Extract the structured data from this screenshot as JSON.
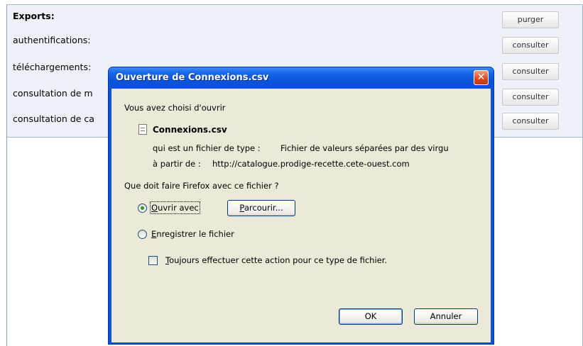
{
  "background": {
    "rows": [
      {
        "label": "Exports:",
        "button": "purger"
      },
      {
        "label": "authentifications:",
        "button": "consulter"
      },
      {
        "label": "téléchargements:",
        "button": "consulter"
      },
      {
        "label": "consultation de m",
        "button": "consulter"
      },
      {
        "label": "consultation de ca",
        "button": "consulter"
      }
    ]
  },
  "dialog": {
    "title": "Ouverture de Connexions.csv",
    "close_glyph": "✕",
    "intro": "Vous avez choisi d'ouvrir",
    "file_name": "Connexions.csv",
    "type_label": "qui est un fichier de type :",
    "type_value": "Fichier de valeurs séparées par des virgu",
    "from_label": "à partir de :",
    "from_value": "http://catalogue.prodige-recette.cete-ouest.com",
    "question": "Que doit faire Firefox avec ce fichier ?",
    "open_with": {
      "accel": "O",
      "rest": "uvrir avec",
      "checked": true
    },
    "browse": {
      "accel": "P",
      "rest": "arcourir..."
    },
    "save_file": {
      "accel": "E",
      "rest": "nregistrer le fichier",
      "checked": false
    },
    "always": {
      "accel": "T",
      "rest": "oujours effectuer cette action pour ce type de fichier.",
      "checked": false
    },
    "ok_label": "OK",
    "cancel_label": "Annuler"
  },
  "colors": {
    "titlebar": "#0a55dc",
    "dialog_body": "#ece9d8",
    "close_button": "#d9451d",
    "panel_background": "#eef2f8"
  }
}
